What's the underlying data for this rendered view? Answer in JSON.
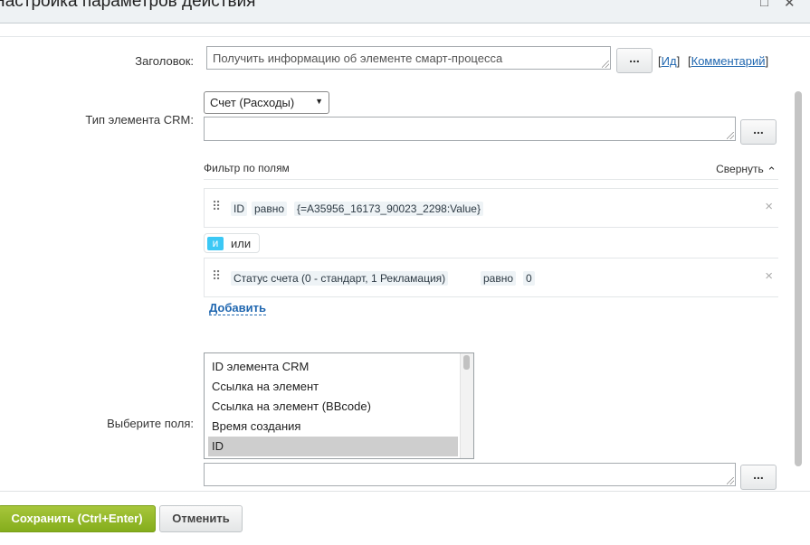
{
  "dialog": {
    "title": "Настройка параметров действия",
    "minimize_icon": "□",
    "close_icon": "✕"
  },
  "form": {
    "title_label": "Заголовок:",
    "title_value": "Получить информацию об элементе смарт-процесса",
    "dots": "...",
    "id_prefix": "[",
    "id_link": "Ид",
    "id_suffix": "]",
    "comment_prefix": "[",
    "comment_link": "Комментарий",
    "comment_suffix": "]",
    "crm_type_label": "Тип элемента CRM:",
    "crm_type_value": "Счет (Расходы)",
    "caret": "▼",
    "filter_title": "Фильтр по полям",
    "collapse_label": "Свернуть",
    "collapse_icon": "⌃",
    "conditions": [
      {
        "field": "ID",
        "op": "равно",
        "value": "{=A35956_16173_90023_2298:Value}"
      },
      {
        "field": "Статус счета (0 - стандарт, 1 Рекламация)",
        "op": "равно",
        "value": "0"
      }
    ],
    "logic_and": "и",
    "logic_or": "или",
    "drag_icon": "⠿",
    "remove_icon": "×",
    "add_label": "Добавить",
    "select_fields_label": "Выберите поля:",
    "fields": [
      "ID элемента CRM",
      "Ссылка на элемент",
      "Ссылка на элемент (BBcode)",
      "Время создания",
      "ID"
    ],
    "selected_field_index": 4
  },
  "footer": {
    "save_label": "Сохранить (Ctrl+Enter)",
    "cancel_label": "Отменить"
  },
  "colors": {
    "save_green": "#8cb72a",
    "link_blue": "#2067b0",
    "logic_active": "#3bc8f5"
  }
}
